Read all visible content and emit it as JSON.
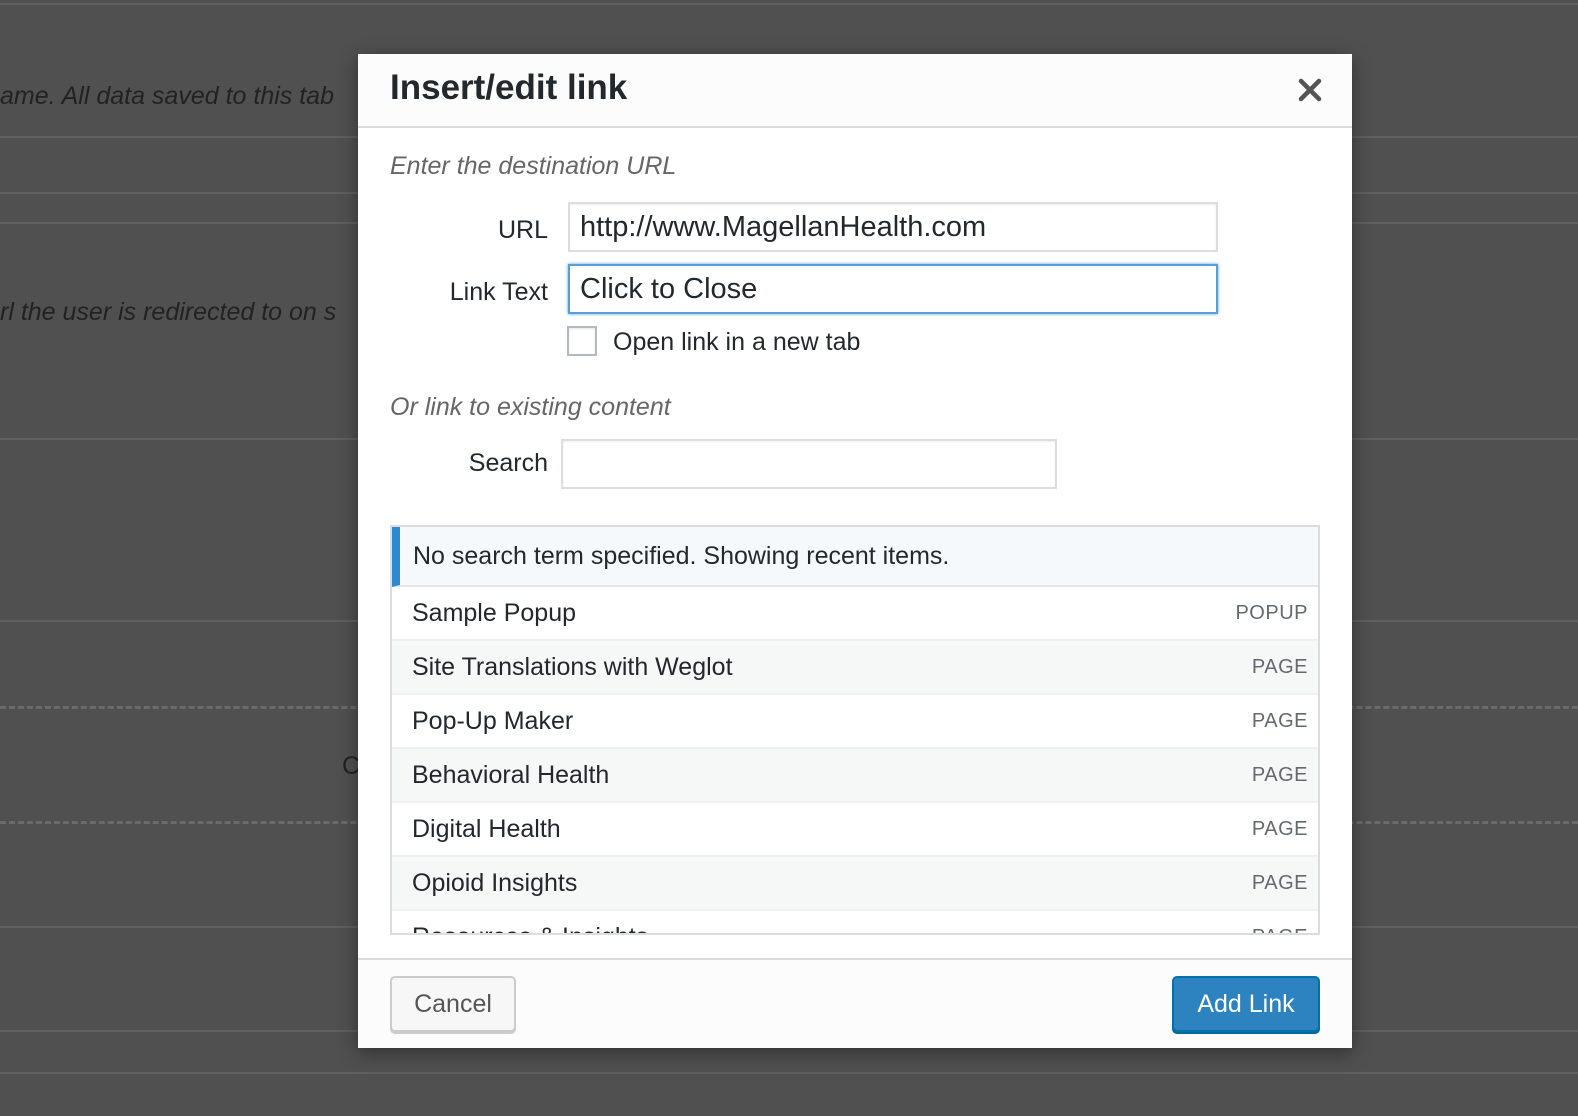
{
  "background": {
    "text_1": "ame. All data saved to this tab",
    "text_2": "rl the user is redirected to on s",
    "letter": "C"
  },
  "dialog": {
    "title": "Insert/edit link",
    "close_icon": "close-icon",
    "url_section_label": "Enter the destination URL",
    "url_label": "URL",
    "url_value": "http://www.MagellanHealth.com",
    "link_text_label": "Link Text",
    "link_text_value": "Click to Close",
    "new_tab_label": "Open link in a new tab",
    "new_tab_checked": false,
    "existing_section_label": "Or link to existing content",
    "search_label": "Search",
    "search_value": "",
    "notice": "No search term specified. Showing recent items.",
    "results": [
      {
        "title": "Sample Popup",
        "type": "POPUP"
      },
      {
        "title": "Site Translations with Weglot",
        "type": "PAGE"
      },
      {
        "title": "Pop-Up Maker",
        "type": "PAGE"
      },
      {
        "title": "Behavioral Health",
        "type": "PAGE"
      },
      {
        "title": "Digital Health",
        "type": "PAGE"
      },
      {
        "title": "Opioid Insights",
        "type": "PAGE"
      },
      {
        "title": "Resources & Insights",
        "type": "PAGE"
      }
    ],
    "cancel_label": "Cancel",
    "add_link_label": "Add Link"
  },
  "colors": {
    "overlay": "#505050",
    "accent": "#2d83bf",
    "notice_border": "#2e8ad0",
    "focus": "#5b9dd9"
  }
}
